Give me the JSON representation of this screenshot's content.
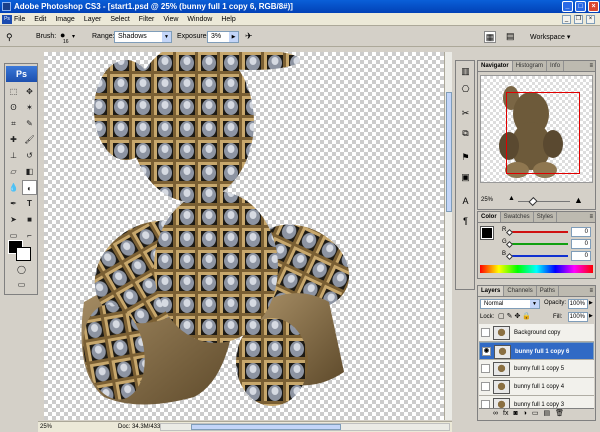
{
  "window": {
    "title": "Adobe Photoshop CS3 - [start1.psd @ 25% (bunny full 1 copy 6, RGB/8#)]"
  },
  "menu": [
    "File",
    "Edit",
    "Image",
    "Layer",
    "Select",
    "Filter",
    "View",
    "Window",
    "Help"
  ],
  "options": {
    "brush_label": "Brush:",
    "brush_size": "16",
    "range_label": "Range:",
    "range_value": "Shadows",
    "exposure_label": "Exposure:",
    "exposure_value": "3%",
    "workspace_label": "Workspace"
  },
  "toolbox": {
    "logo": "Ps"
  },
  "status": {
    "zoom": "25%",
    "doc": "Doc: 34.3M/433.1M"
  },
  "navigator": {
    "tabs": [
      "Navigator",
      "Histogram",
      "Info"
    ],
    "zoom": "25%"
  },
  "color_panel": {
    "tabs": [
      "Color",
      "Swatches",
      "Styles"
    ],
    "channels": [
      {
        "label": "R",
        "value": "0",
        "color": "#d01010"
      },
      {
        "label": "G",
        "value": "0",
        "color": "#10a010"
      },
      {
        "label": "B",
        "value": "0",
        "color": "#1030d0"
      }
    ]
  },
  "layers_panel": {
    "tabs": [
      "Layers",
      "Channels",
      "Paths"
    ],
    "blend_mode": "Normal",
    "opacity_label": "Opacity:",
    "opacity_value": "100%",
    "lock_label": "Lock:",
    "fill_label": "Fill:",
    "fill_value": "100%",
    "layers": [
      {
        "name": "Background copy",
        "visible": false,
        "selected": false
      },
      {
        "name": "bunny full 1 copy 6",
        "visible": true,
        "selected": true
      },
      {
        "name": "bunny full 1 copy 5",
        "visible": false,
        "selected": false
      },
      {
        "name": "bunny full 1 copy 4",
        "visible": false,
        "selected": false
      },
      {
        "name": "bunny full 1 copy 3",
        "visible": false,
        "selected": false
      }
    ]
  },
  "colors": {
    "accent": "#316ac5",
    "title_bar": "#0a5fd8"
  }
}
